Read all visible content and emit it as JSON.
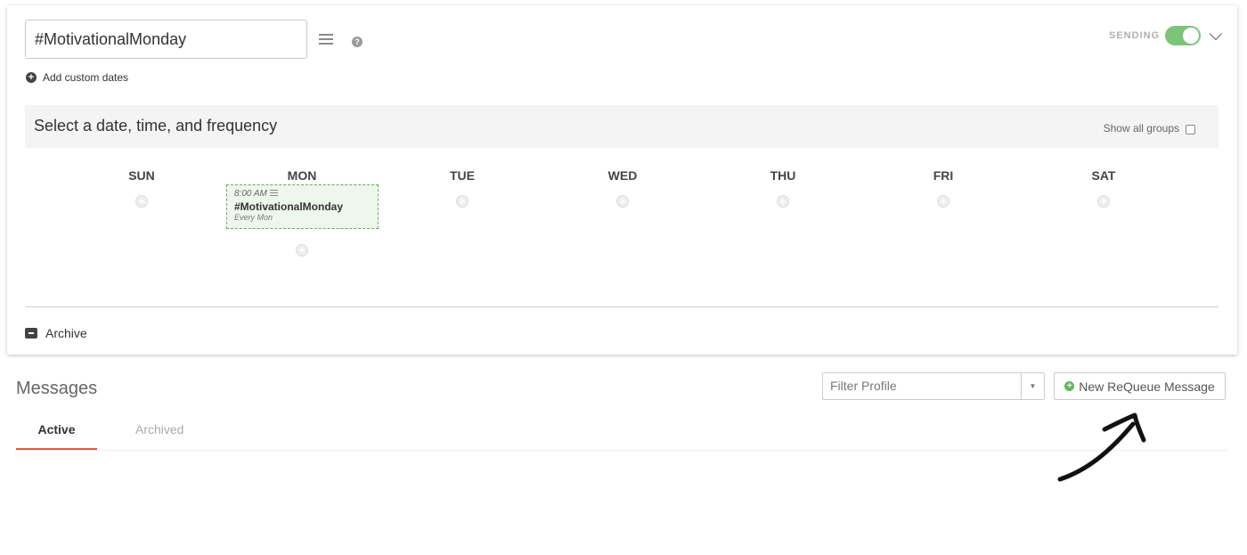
{
  "header": {
    "name_value": "#MotivationalMonday",
    "add_custom_dates_label": "Add custom dates",
    "sending_label": "SENDING"
  },
  "frequency": {
    "title": "Select a date, time, and frequency",
    "show_all_groups_label": "Show all groups"
  },
  "days": [
    "SUN",
    "MON",
    "TUE",
    "WED",
    "THU",
    "FRI",
    "SAT"
  ],
  "slot": {
    "time": "8:00 AM",
    "title": "#MotivationalMonday",
    "frequency": "Every Mon"
  },
  "archive_label": "Archive",
  "messages": {
    "title": "Messages",
    "filter_placeholder": "Filter Profile",
    "new_button_label": "New ReQueue Message",
    "tabs": [
      {
        "label": "Active",
        "active": true
      },
      {
        "label": "Archived",
        "active": false
      }
    ]
  },
  "colors": {
    "toggle_on": "#7cc47a",
    "active_tab_underline": "#d65a4a",
    "slot_border": "#6aa866"
  }
}
